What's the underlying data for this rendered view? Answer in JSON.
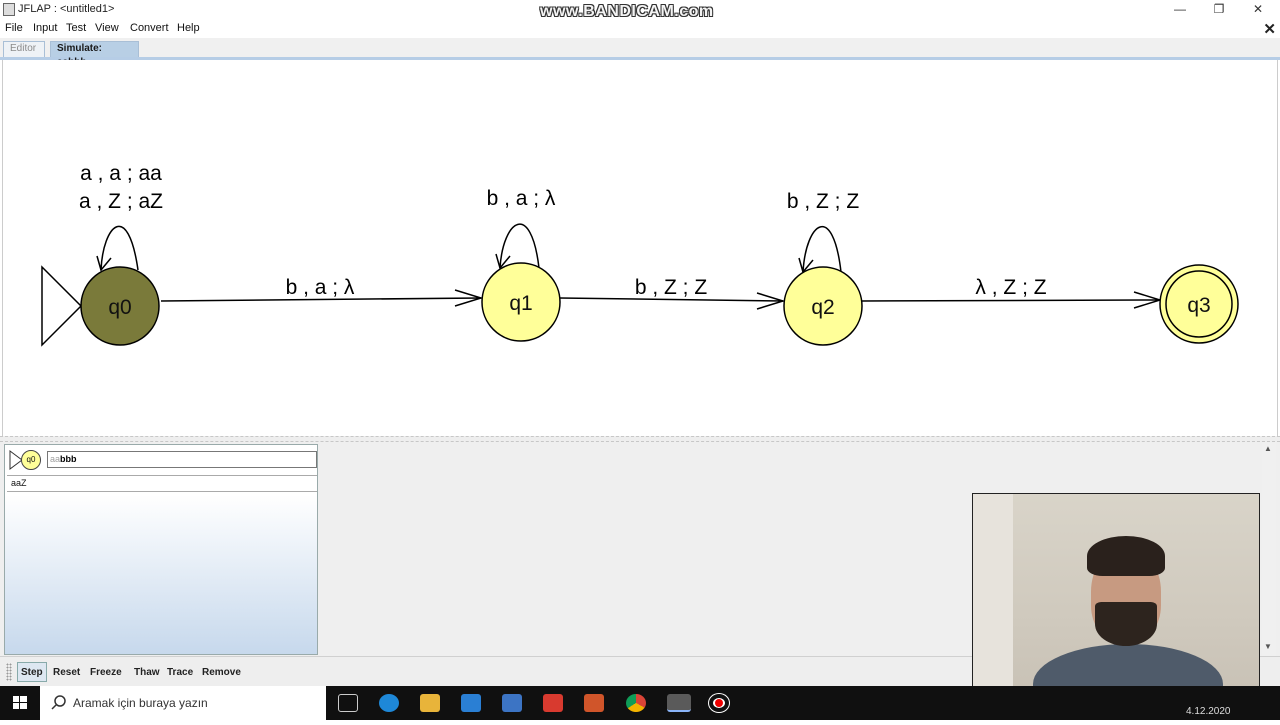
{
  "window": {
    "title": "JFLAP : <untitled1>",
    "watermark": "www.BANDICAM.com"
  },
  "menu": {
    "items": [
      "File",
      "Input",
      "Test",
      "View",
      "Convert",
      "Help"
    ]
  },
  "tabs": {
    "editor": "Editor",
    "simulate": "Simulate: aabbb"
  },
  "automaton": {
    "states": {
      "q0": "q0",
      "q1": "q1",
      "q2": "q2",
      "q3": "q3"
    },
    "labels": {
      "q0_loop_1": "a , a ; aa",
      "q0_loop_2": "a , Z ; aZ",
      "q0_q1": "b , a ; λ",
      "q1_loop": "b , a ; λ",
      "q1_q2": "b , Z ; Z",
      "q2_loop": "b , Z ; Z",
      "q2_q3": "λ , Z ; Z"
    },
    "colors": {
      "current_state": "#7a7a3a",
      "state": "#ffff99",
      "edge": "#000000"
    }
  },
  "simulation": {
    "current_state": "q0",
    "input_consumed": "aa",
    "input_remaining": "bbb",
    "stack": "aaZ"
  },
  "toolbar": {
    "step": "Step",
    "reset": "Reset",
    "freeze": "Freeze",
    "thaw": "Thaw",
    "trace": "Trace",
    "remove": "Remove"
  },
  "taskbar": {
    "search_placeholder": "Aramak için buraya yazın",
    "date": "4.12.2020"
  }
}
